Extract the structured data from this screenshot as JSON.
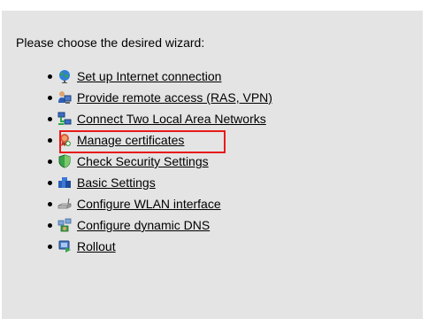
{
  "prompt": "Please choose the desired wizard:",
  "wizards": [
    {
      "label": "Set up Internet connection",
      "icon": "globe-icon"
    },
    {
      "label": "Provide remote access (RAS, VPN)",
      "icon": "remote-access-icon"
    },
    {
      "label": "Connect Two Local Area Networks",
      "icon": "network-icon"
    },
    {
      "label": "Manage certificates",
      "icon": "certificate-icon",
      "highlighted": true
    },
    {
      "label": "Check Security Settings",
      "icon": "shield-icon"
    },
    {
      "label": "Basic Settings",
      "icon": "basic-settings-icon"
    },
    {
      "label": "Configure WLAN interface",
      "icon": "wlan-icon"
    },
    {
      "label": "Configure dynamic DNS",
      "icon": "dns-icon"
    },
    {
      "label": "Rollout",
      "icon": "rollout-icon"
    }
  ],
  "colors": {
    "panel_background": "#e4e4e4",
    "highlight_border": "#e81a1a"
  }
}
